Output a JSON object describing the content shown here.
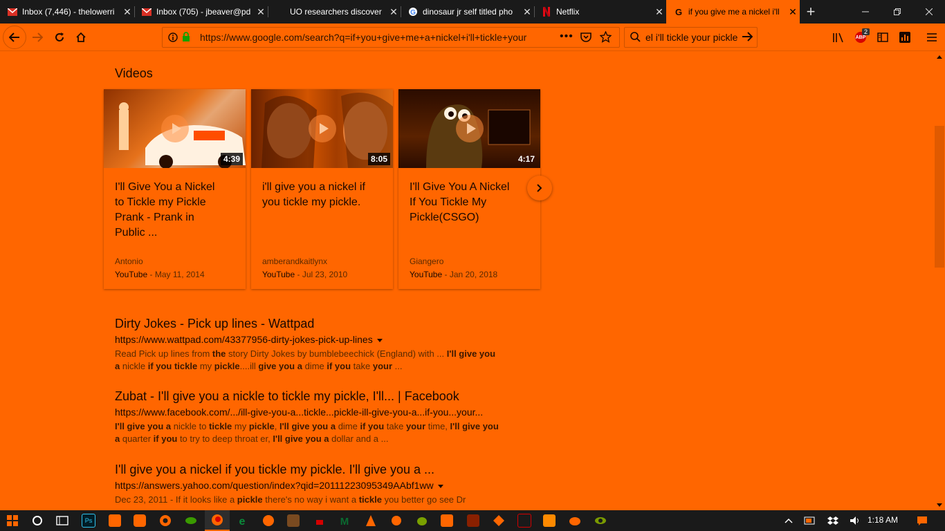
{
  "browser": {
    "tabs": [
      {
        "label": "Inbox (7,446) - thelowerri",
        "icon": "gmail-icon"
      },
      {
        "label": "Inbox (705) - jbeaver@pd",
        "icon": "gmail-icon"
      },
      {
        "label": "UO researchers discover",
        "icon": "news-icon"
      },
      {
        "label": "dinosaur jr self titled pho",
        "icon": "google-icon"
      },
      {
        "label": "Netflix",
        "icon": "netflix-icon"
      },
      {
        "label": "if you give me a nickel i'll",
        "icon": "google-icon"
      }
    ],
    "active_tab": 5,
    "url": "https://www.google.com/search?q=if+you+give+me+a+nickel+i'll+tickle+your",
    "search_value": "el i'll tickle your pickle",
    "addon_badge": "2",
    "addon_label": "ABP"
  },
  "videos": {
    "heading": "Videos",
    "items": [
      {
        "title": "I'll Give You a Nickel to Tickle my Pickle Prank - Prank in Public ...",
        "duration": "4:39",
        "author": "Antonio",
        "source": "YouTube",
        "date": " - May 11, 2014"
      },
      {
        "title": "i'll give you a nickel if you tickle my pickle.",
        "duration": "8:05",
        "author": "amberandkaitlynx",
        "source": "YouTube",
        "date": " - Jul 23, 2010"
      },
      {
        "title": "I'll Give You A Nickel If You Tickle My Pickle(CSGO)",
        "duration": "4:17",
        "author": "Giangero",
        "source": "YouTube",
        "date": " - Jan 20, 2018"
      }
    ]
  },
  "results": [
    {
      "title": "Dirty Jokes - Pick up lines - Wattpad",
      "url": "https://www.wattpad.com/43377956-dirty-jokes-pick-up-lines",
      "snippet_html": "Read Pick up lines from <b>the</b> story Dirty Jokes by bumblebeechick (England) with ... <b>I'll give you a</b> nickle <b>if you tickle</b> my <b>pickle</b>....ill <b>give you a</b> dime <b>if you</b> take <b>your</b> ..."
    },
    {
      "title": "Zubat - I'll give you a nickle to tickle my pickle, I'll... | Facebook",
      "url": "https://www.facebook.com/.../ill-give-you-a...tickle...pickle-ill-give-you-a...if-you...your...",
      "snippet_html": "<b>I'll give you a</b> nickle to <b>tickle</b> my <b>pickle</b>, <b>I'll give you a</b> dime <b>if you</b> take <b>your</b> time, <b>I'll give you a</b> quarter <b>if you</b> to try to deep throat er, <b>I'll give you a</b> dollar and a ..."
    },
    {
      "title": "I'll give you a nickel if you tickle my pickle. I'll give you a ...",
      "url": "https://answers.yahoo.com/question/index?qid=20111223095349AAbf1ww",
      "snippet_html": "Dec 23, 2011 - If it looks like a <b>pickle</b> there's no way i want a <b>tickle</b> you better go see Dr"
    }
  ],
  "taskbar": {
    "clock": "1:18 AM",
    "apps": [
      "start",
      "cortana",
      "task-view",
      "photoshop",
      "file-explorer",
      "dropbox",
      "chrome",
      "app-green",
      "firefox",
      "edge",
      "firefox-alt",
      "package",
      "red-app",
      "malwarebytes",
      "vlc",
      "sonic",
      "hollow",
      "brave-pdf",
      "film",
      "git",
      "dosbox",
      "winrar",
      "paint",
      "tor"
    ]
  }
}
